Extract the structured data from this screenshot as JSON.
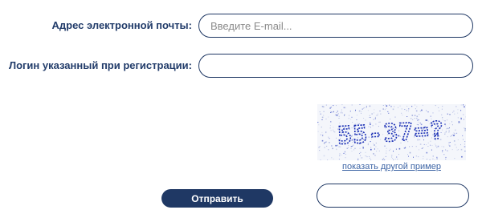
{
  "form": {
    "email_label": "Адрес электронной почты:",
    "email_placeholder": "Введите E-mail...",
    "email_value": "",
    "login_label": "Логин указанный при регистрации:",
    "login_value": "",
    "captcha_text": "55-37=?",
    "captcha_refresh_label": "показать другой пример",
    "captcha_answer_value": "",
    "submit_label": "Отправить"
  },
  "colors": {
    "label": "#223c6a",
    "border": "#1f3864",
    "button_bg": "#1f3864",
    "link": "#3f66a6",
    "captcha_ink": "#1a2fb5"
  }
}
